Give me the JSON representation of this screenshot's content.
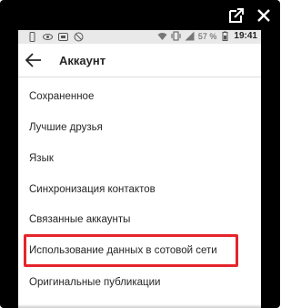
{
  "top_icons": [
    "open-external-icon",
    "close-icon"
  ],
  "statusbar": {
    "left_icons": [
      "phone-icon",
      "eye-icon",
      "screen-record-icon",
      "no-signal-icon"
    ],
    "right_icons": [
      "wifi-icon",
      "vibrate-icon",
      "signal-icon"
    ],
    "battery": "57 %",
    "time": "19:41"
  },
  "appbar": {
    "back_icon": "arrow-left-icon",
    "title": "Аккаунт"
  },
  "menu": {
    "items": [
      {
        "label": "Сохраненное"
      },
      {
        "label": "Лучшие друзья"
      },
      {
        "label": "Язык"
      },
      {
        "label": "Синхронизация контактов"
      },
      {
        "label": "Связанные аккаунты"
      },
      {
        "label": "Использование данных в сотовой сети",
        "highlighted": true
      },
      {
        "label": "Оригинальные публикации"
      }
    ]
  },
  "colors": {
    "highlight": "#e5242b",
    "statusbar_bg": "#e9e9e9",
    "frame": "#000000"
  }
}
